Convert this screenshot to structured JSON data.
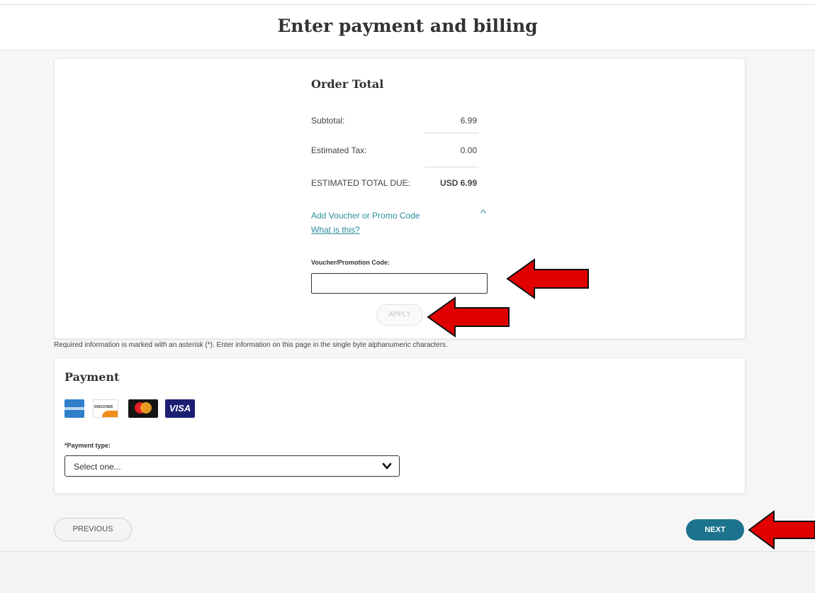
{
  "header": {
    "title": "Enter payment and billing"
  },
  "order_total": {
    "title": "Order Total",
    "subtotal_label": "Subtotal:",
    "subtotal_value": "6.99",
    "tax_label": "Estimated Tax:",
    "tax_value": "0.00",
    "total_label": "ESTIMATED TOTAL DUE:",
    "total_value": "USD 6.99",
    "promo_link": "Add Voucher or Promo Code",
    "what_link": "What is this?",
    "voucher_label": "Voucher/Promotion Code:",
    "voucher_value": "",
    "apply_label": "APPLY"
  },
  "required_note": "Required information is marked with an asterisk (*). Enter information on this page in the single byte alphanumeric characters.",
  "payment": {
    "title": "Payment",
    "cards": [
      "amex-icon",
      "discover-icon",
      "mastercard-icon",
      "visa-icon"
    ],
    "discover_text": "DISCOVER",
    "visa_text": "VISA",
    "type_label": "*Payment type:",
    "type_selected": "Select one..."
  },
  "nav": {
    "previous_label": "PREVIOUS",
    "next_label": "NEXT"
  },
  "colors": {
    "accent": "#1b738d",
    "link": "#2a8c9e",
    "annotation_arrow": "#e00000"
  }
}
